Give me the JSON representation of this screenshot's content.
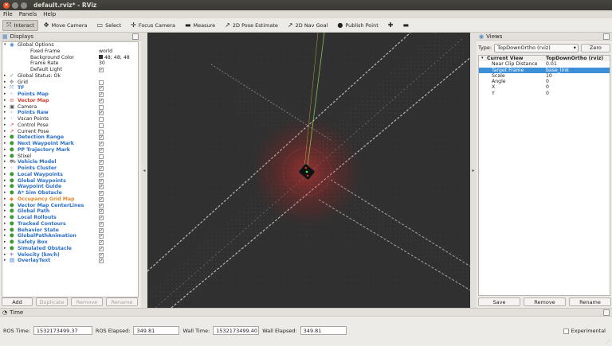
{
  "window": {
    "title": "default.rviz* - RViz"
  },
  "menu": [
    "File",
    "Panels",
    "Help"
  ],
  "toolbar": [
    {
      "label": "Interact",
      "icon": "interact-icon",
      "glyph": "⤧",
      "active": true
    },
    {
      "label": "Move Camera",
      "icon": "move-camera-icon",
      "glyph": "✥"
    },
    {
      "label": "Select",
      "icon": "select-icon",
      "glyph": "▭"
    },
    {
      "label": "Focus Camera",
      "icon": "focus-camera-icon",
      "glyph": "✛"
    },
    {
      "label": "Measure",
      "icon": "measure-icon",
      "glyph": "▬"
    },
    {
      "label": "2D Pose Estimate",
      "icon": "pose-estimate-icon",
      "glyph": "↗"
    },
    {
      "label": "2D Nav Goal",
      "icon": "nav-goal-icon",
      "glyph": "↗"
    },
    {
      "label": "Publish Point",
      "icon": "publish-point-icon",
      "glyph": "●"
    },
    {
      "label": "",
      "icon": "add-tool-icon",
      "glyph": "✚"
    },
    {
      "label": "",
      "icon": "remove-tool-icon",
      "glyph": "▬"
    }
  ],
  "displays": {
    "title": "Displays",
    "rows": [
      {
        "name": "Global Options",
        "indent": 0,
        "arrow": "▾",
        "icon": "globe-icon",
        "glyph": "◉",
        "color": "#4a88c7"
      },
      {
        "name": "Fixed Frame",
        "indent": 1,
        "value": "world"
      },
      {
        "name": "Background Color",
        "indent": 1,
        "value": "48; 48; 48",
        "swatch": true
      },
      {
        "name": "Frame Rate",
        "indent": 1,
        "value": "30"
      },
      {
        "name": "Default Light",
        "indent": 1,
        "check": true
      },
      {
        "name": "Global Status: Ok",
        "indent": 0,
        "arrow": "▸",
        "icon": "status-ok-icon",
        "glyph": "✓",
        "color": "#3c9a32"
      },
      {
        "name": "Grid",
        "indent": 0,
        "arrow": "▸",
        "icon": "grid-icon",
        "glyph": "✥",
        "color": "#888",
        "check": false
      },
      {
        "name": "TF",
        "indent": 0,
        "arrow": "▸",
        "icon": "tf-icon",
        "glyph": "⤧",
        "color": "#2a6fc9",
        "cls": "blue",
        "check": true
      },
      {
        "name": "Points Map",
        "indent": 0,
        "arrow": "▸",
        "icon": "points-icon",
        "glyph": "⁘",
        "color": "#2a6fc9",
        "cls": "blue",
        "check": true
      },
      {
        "name": "Vector Map",
        "indent": 0,
        "arrow": "▸",
        "icon": "error-icon",
        "glyph": "⊖",
        "color": "#d43b2c",
        "cls": "red",
        "check": true
      },
      {
        "name": "Camera",
        "indent": 0,
        "arrow": "▸",
        "icon": "camera-icon",
        "glyph": "▣",
        "color": "#555",
        "check": false
      },
      {
        "name": "Points Raw",
        "indent": 0,
        "arrow": "▸",
        "icon": "points-icon",
        "glyph": "⁘",
        "color": "#2a6fc9",
        "cls": "blue",
        "check": true
      },
      {
        "name": "Vscan Points",
        "indent": 0,
        "arrow": "▸",
        "icon": "points-icon",
        "glyph": "⁘",
        "color": "#6a9fd8",
        "check": false
      },
      {
        "name": "Control Pose",
        "indent": 0,
        "arrow": "▸",
        "icon": "pose-icon",
        "glyph": "↗",
        "color": "#d43b2c",
        "check": false
      },
      {
        "name": "Current Pose",
        "indent": 0,
        "arrow": "▸",
        "icon": "pose-icon",
        "glyph": "↗",
        "color": "#d43b2c",
        "check": false
      },
      {
        "name": "Detection Range",
        "indent": 0,
        "arrow": "▸",
        "icon": "marker-icon",
        "glyph": "⬢",
        "color": "#3c9a32",
        "cls": "blue",
        "check": true
      },
      {
        "name": "Next Waypoint Mark",
        "indent": 0,
        "arrow": "▸",
        "icon": "marker-icon",
        "glyph": "⬢",
        "color": "#3c9a32",
        "cls": "blue",
        "check": true
      },
      {
        "name": "PP Trajectory Mark",
        "indent": 0,
        "arrow": "▸",
        "icon": "marker-icon",
        "glyph": "⬢",
        "color": "#3c9a32",
        "cls": "blue",
        "check": true
      },
      {
        "name": "Stixel",
        "indent": 0,
        "arrow": "▸",
        "icon": "marker-icon",
        "glyph": "⬢",
        "color": "#3c9a32",
        "check": false
      },
      {
        "name": "Vehicle Model",
        "indent": 0,
        "arrow": "▸",
        "icon": "robot-model-icon",
        "glyph": "⛟",
        "color": "#888",
        "cls": "blue",
        "check": true
      },
      {
        "name": "Points Cluster",
        "indent": 0,
        "arrow": "▸",
        "icon": "points-icon",
        "glyph": "⁘",
        "color": "#2a6fc9",
        "cls": "blue",
        "check": true
      },
      {
        "name": "Local Waypoints",
        "indent": 0,
        "arrow": "▸",
        "icon": "marker-icon",
        "glyph": "⬢",
        "color": "#3c9a32",
        "cls": "blue",
        "check": true
      },
      {
        "name": "Global Waypoints",
        "indent": 0,
        "arrow": "▸",
        "icon": "marker-icon",
        "glyph": "⬢",
        "color": "#3c9a32",
        "cls": "blue",
        "check": true
      },
      {
        "name": "Waypoint Guide",
        "indent": 0,
        "arrow": "▸",
        "icon": "marker-icon",
        "glyph": "⬢",
        "color": "#3c9a32",
        "cls": "blue",
        "check": true
      },
      {
        "name": "A* Sim Obstacle",
        "indent": 0,
        "arrow": "▸",
        "icon": "marker-icon",
        "glyph": "⬢",
        "color": "#3c9a32",
        "cls": "blue",
        "check": true
      },
      {
        "name": "Occupancy Grid Map",
        "indent": 0,
        "arrow": "▸",
        "icon": "warning-icon",
        "glyph": "◆",
        "color": "#e08a2c",
        "cls": "orange",
        "check": true
      },
      {
        "name": "Vector Map CenterLines",
        "indent": 0,
        "arrow": "▸",
        "icon": "marker-icon",
        "glyph": "⬢",
        "color": "#3c9a32",
        "cls": "blue",
        "check": true
      },
      {
        "name": "Global Path",
        "indent": 0,
        "arrow": "▸",
        "icon": "marker-icon",
        "glyph": "⬢",
        "color": "#3c9a32",
        "cls": "blue",
        "check": true
      },
      {
        "name": "Local Rollouts",
        "indent": 0,
        "arrow": "▸",
        "icon": "marker-icon",
        "glyph": "⬢",
        "color": "#3c9a32",
        "cls": "blue",
        "check": true
      },
      {
        "name": "Tracked Contours",
        "indent": 0,
        "arrow": "▸",
        "icon": "marker-icon",
        "glyph": "⬢",
        "color": "#3c9a32",
        "cls": "blue",
        "check": true
      },
      {
        "name": "Behavior State",
        "indent": 0,
        "arrow": "▸",
        "icon": "marker-icon",
        "glyph": "⬢",
        "color": "#3c9a32",
        "cls": "blue",
        "check": true
      },
      {
        "name": "GlobalPathAnimation",
        "indent": 0,
        "arrow": "▸",
        "icon": "marker-icon",
        "glyph": "⬢",
        "color": "#3c9a32",
        "cls": "blue",
        "check": true
      },
      {
        "name": "Safety Box",
        "indent": 0,
        "arrow": "▸",
        "icon": "marker-icon",
        "glyph": "⬢",
        "color": "#3c9a32",
        "cls": "blue",
        "check": true
      },
      {
        "name": "Simulated Obstacle",
        "indent": 0,
        "arrow": "▸",
        "icon": "marker-icon",
        "glyph": "⬢",
        "color": "#3c9a32",
        "cls": "blue",
        "check": true
      },
      {
        "name": "Velocity (km/h)",
        "indent": 0,
        "arrow": "▸",
        "icon": "text-icon",
        "glyph": "⁜",
        "color": "#7a5bb5",
        "cls": "blue",
        "check": true
      },
      {
        "name": "OverlayText",
        "indent": 0,
        "arrow": "▸",
        "icon": "text-icon",
        "glyph": "▤",
        "color": "#2a6fc9",
        "cls": "blue",
        "check": true
      }
    ],
    "buttons": [
      {
        "label": "Add",
        "disabled": false,
        "w": 39
      },
      {
        "label": "Duplicate",
        "disabled": true,
        "w": 40
      },
      {
        "label": "Remove",
        "disabled": true,
        "w": 40
      },
      {
        "label": "Rename",
        "disabled": true,
        "w": 40
      }
    ]
  },
  "views": {
    "title": "Views",
    "type_label": "Type:",
    "type_value": "TopDownOrtho (rviz)",
    "zero_label": "Zero",
    "rows": [
      {
        "k": "Current View",
        "v": "TopDownOrtho (rviz)",
        "head": true
      },
      {
        "k": "Near Clip Distance",
        "v": "0.01"
      },
      {
        "k": "Target Frame",
        "v": "base_link",
        "sel": true
      },
      {
        "k": "Scale",
        "v": "10"
      },
      {
        "k": "Angle",
        "v": "0"
      },
      {
        "k": "X",
        "v": "0"
      },
      {
        "k": "Y",
        "v": "0"
      }
    ],
    "buttons": [
      "Save",
      "Remove",
      "Rename"
    ]
  },
  "time": {
    "title": "Time",
    "ros_time_label": "ROS Time:",
    "ros_time": "1532173499.37",
    "ros_elapsed_label": "ROS Elapsed:",
    "ros_elapsed": "349.81",
    "wall_time_label": "Wall Time:",
    "wall_time": "1532173499.40",
    "wall_elapsed_label": "Wall Elapsed:",
    "wall_elapsed": "349.81",
    "experimental_label": "Experimental"
  }
}
